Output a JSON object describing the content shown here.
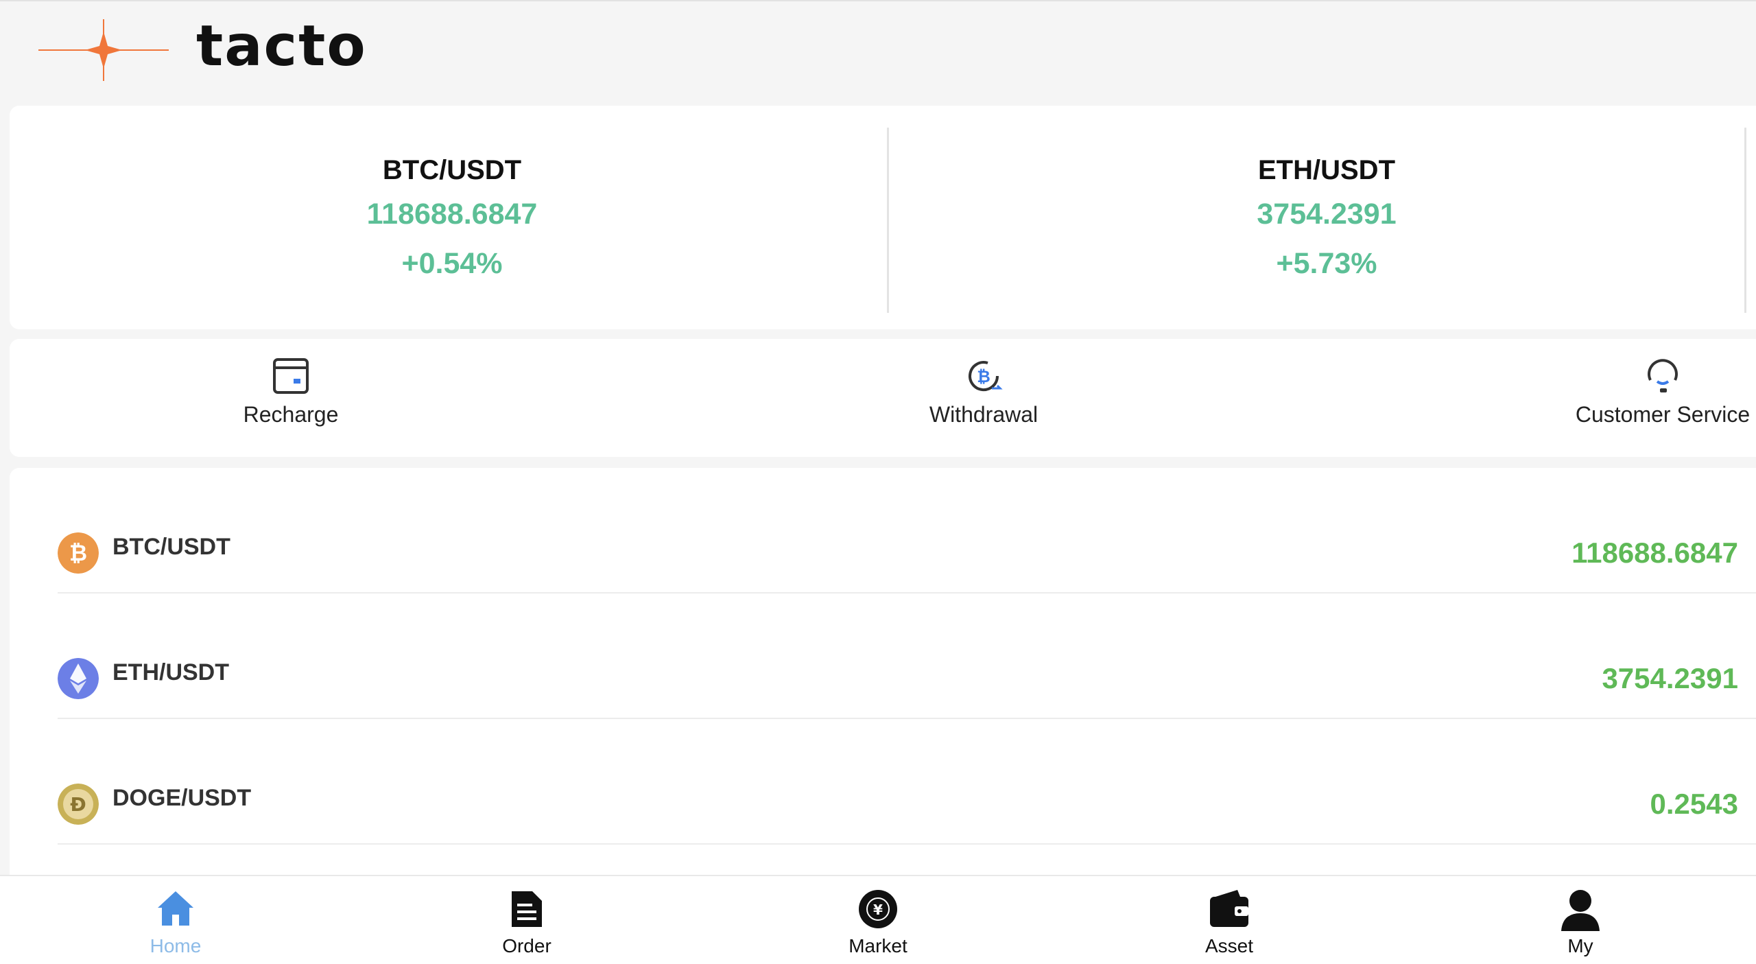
{
  "brand": {
    "name": "tacto",
    "accent": "#f0763a"
  },
  "tickers": [
    {
      "pair": "BTC/USDT",
      "price": "118688.6847",
      "change": "+0.54%"
    },
    {
      "pair": "ETH/USDT",
      "price": "3754.2391",
      "change": "+5.73%"
    }
  ],
  "actions": [
    {
      "label": "Recharge",
      "icon": "card-icon"
    },
    {
      "label": "Withdrawal",
      "icon": "bitcoin-withdraw-icon"
    },
    {
      "label": "Customer Service",
      "icon": "headset-icon"
    }
  ],
  "markets": [
    {
      "symbol": "BTC/USDT",
      "price": "118688.6847",
      "icon": "bitcoin-icon",
      "color": "#ec9849"
    },
    {
      "symbol": "ETH/USDT",
      "price": "3754.2391",
      "icon": "ethereum-icon",
      "color": "#6c7fe6"
    },
    {
      "symbol": "DOGE/USDT",
      "price": "0.2543",
      "icon": "dogecoin-icon",
      "color": "#c8b157"
    }
  ],
  "tabbar": [
    {
      "label": "Home",
      "icon": "home-icon",
      "active": true
    },
    {
      "label": "Order",
      "icon": "document-icon",
      "active": false
    },
    {
      "label": "Market",
      "icon": "market-icon",
      "active": false
    },
    {
      "label": "Asset",
      "icon": "wallet-icon",
      "active": false
    },
    {
      "label": "My",
      "icon": "user-icon",
      "active": false
    }
  ],
  "colors": {
    "up": "#5cbf96",
    "price_green": "#5fb957",
    "active_tab": "#8dbbe7",
    "home_icon": "#4a8fe0"
  }
}
